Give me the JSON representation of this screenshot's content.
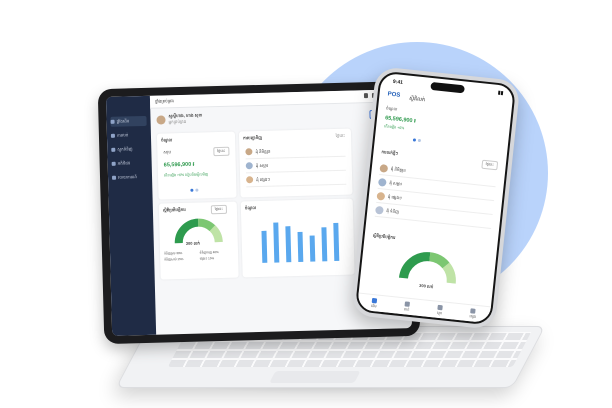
{
  "brand": {
    "accent": "#3a78d8",
    "sidebar_bg": "#1f2b45",
    "success": "#2f9a4e",
    "bar_color": "#5aa8ee",
    "circle_bg": "#b9d3fb"
  },
  "tablet": {
    "topbar_title": "ផ្ទាំងគ្រប់គ្រង",
    "sidebar": [
      "ផ្ទាំងដើម",
      "ការលក់",
      "ស្តុកទំនិញ",
      "អតិថិជន",
      "របាយការណ៍"
    ],
    "user_name": "សួស្តីហាង, ហាង សុខា",
    "user_sub": "អ្នកគ្រប់គ្រង",
    "top_button": "មើលរបាយការណ៍",
    "sales_card": {
      "title": "ចំណូល",
      "label": "សរុប",
      "pill": "ថ្ងៃនេះ",
      "amount": "65,596,900 ៛",
      "note": "កើនឡើង +6% ធៀបនឹងម្សិលមិញ"
    },
    "orders_card": {
      "title": "ការបញ្ជាទិញ",
      "filter": "ថ្ងៃនេះ",
      "items": [
        "ដុំ និមិត្តរុន",
        "ដុំ សម្ភារ",
        "ដុំ ផ្សេងៗ"
      ]
    },
    "gauge_card": {
      "title": "ស្ថិតិប្រតិបត្តិការ",
      "pill": "ថ្ងៃនេះ",
      "value": "300 លក់",
      "legend": [
        "ទំនិញចូល 30%",
        "ទំនិញចេញ 40%",
        "ទំនិញសល់ 15%",
        "ផ្សេងៗ 15%"
      ]
    },
    "chart_card": {
      "title": "ចំណូល"
    }
  },
  "phone": {
    "time": "9:41",
    "logo": "POS",
    "title": "ស្ថិតិលក់",
    "sales_label": "ចំណូល",
    "amount": "65,596,900 ៛",
    "note": "កើនឡើង +6%",
    "orders_title": "ការលក់ថ្មីៗ",
    "orders_pill": "ថ្ងៃនេះ",
    "orders": [
      "ដុំ និមិត្តរុន",
      "ដុំ សម្ភារ",
      "ដុំ ផ្សេងៗ",
      "ដុំ ទំនិញ"
    ],
    "gauge_title": "ស្ថិតិប្រតិបត្តិការ",
    "gauge_value": "300 លក់",
    "tabs": [
      "ដើម",
      "លក់",
      "ស្តុក",
      "ផ្សេង"
    ]
  }
}
